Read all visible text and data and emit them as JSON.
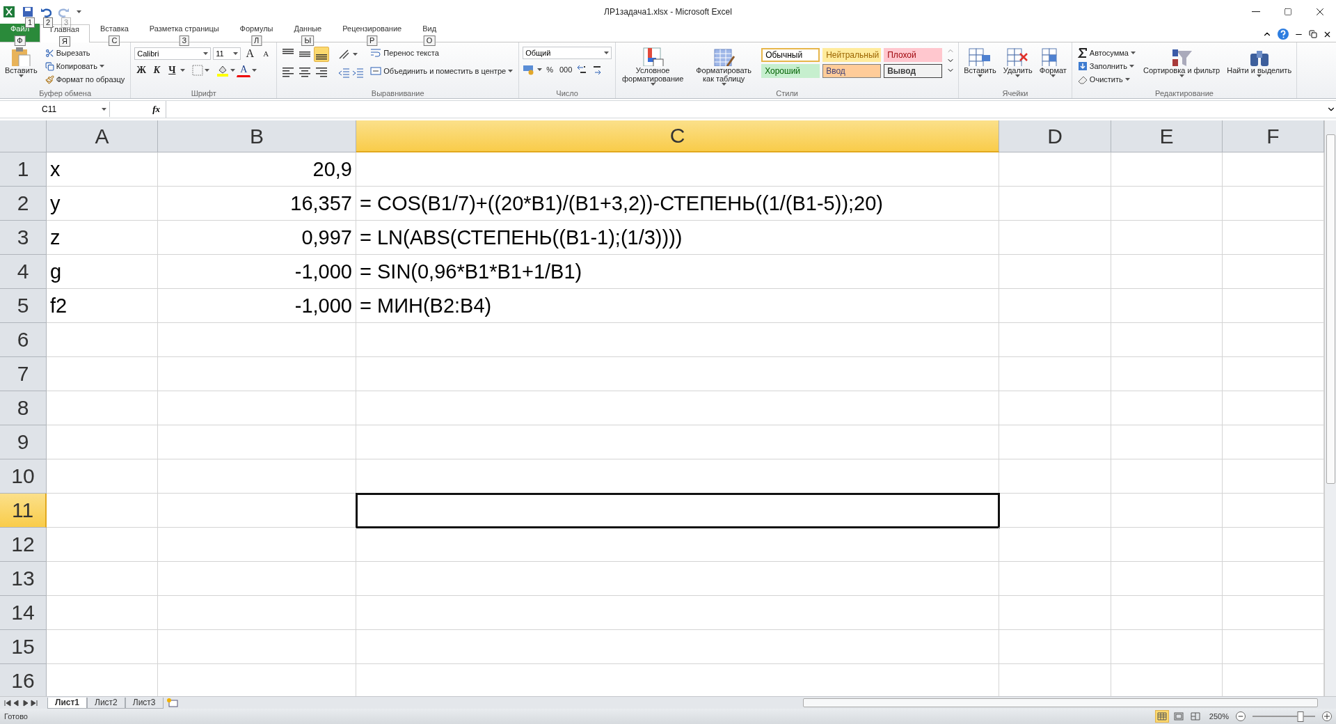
{
  "window": {
    "title": "ЛР1задача1.xlsx  -  Microsoft Excel"
  },
  "quick_access": [
    {
      "kind": "save",
      "keytip": "1",
      "disabled": false
    },
    {
      "kind": "undo",
      "keytip": "2",
      "disabled": false
    },
    {
      "kind": "redo",
      "keytip": "3",
      "disabled": true
    }
  ],
  "tabs": [
    {
      "label": "Файл",
      "keytip": "Ф",
      "kind": "file",
      "selected": false
    },
    {
      "label": "Главная",
      "keytip": "Я",
      "kind": "tab",
      "selected": true
    },
    {
      "label": "Вставка",
      "keytip": "С",
      "kind": "tab",
      "selected": false
    },
    {
      "label": "Разметка страницы",
      "keytip": "З",
      "kind": "tab",
      "selected": false
    },
    {
      "label": "Формулы",
      "keytip": "Л",
      "kind": "tab",
      "selected": false
    },
    {
      "label": "Данные",
      "keytip": "Ы",
      "kind": "tab",
      "selected": false
    },
    {
      "label": "Рецензирование",
      "keytip": "Р",
      "kind": "tab",
      "selected": false
    },
    {
      "label": "Вид",
      "keytip": "О",
      "kind": "tab",
      "selected": false
    }
  ],
  "ribbon": {
    "clipboard": {
      "label": "Буфер обмена",
      "paste": "Вставить",
      "items": [
        {
          "kind": "cut",
          "label": "Вырезать",
          "menu": false
        },
        {
          "kind": "copy",
          "label": "Копировать",
          "menu": true
        },
        {
          "kind": "brush",
          "label": "Формат по образцу",
          "menu": false
        }
      ]
    },
    "font": {
      "label": "Шрифт",
      "family": "Calibri",
      "size": "11",
      "grow": "A",
      "shrink": "A",
      "bold": "Ж",
      "italic": "К",
      "underline": "Ч",
      "color_letter": "A"
    },
    "alignment": {
      "label": "Выравнивание",
      "buttons": [
        {
          "kind": "top",
          "selected": false
        },
        {
          "kind": "middle",
          "selected": false
        },
        {
          "kind": "bottom",
          "selected": true
        },
        {
          "kind": "left",
          "selected": false
        },
        {
          "kind": "center",
          "selected": false
        },
        {
          "kind": "right",
          "selected": false
        }
      ],
      "wrap": "Перенос текста",
      "merge": "Объединить и поместить в центре"
    },
    "number": {
      "label": "Число",
      "format": "Общий",
      "percent": "%",
      "thousands": "000"
    },
    "styles": {
      "label": "Стили",
      "conditional": "Условное форматирование",
      "as_table": "Форматировать как таблицу",
      "cells": [
        {
          "label": "Обычный",
          "kind": "normal",
          "selected": true
        },
        {
          "label": "Нейтральный",
          "kind": "neutral",
          "selected": false
        },
        {
          "label": "Плохой",
          "kind": "bad",
          "selected": false
        },
        {
          "label": "Хороший",
          "kind": "good",
          "selected": false
        },
        {
          "label": "Ввод",
          "kind": "input",
          "selected": false
        },
        {
          "label": "Вывод",
          "kind": "output",
          "selected": false
        }
      ]
    },
    "cells": {
      "label": "Ячейки",
      "buttons": [
        {
          "kind": "insert",
          "label": "Вставить"
        },
        {
          "kind": "delete",
          "label": "Удалить"
        },
        {
          "kind": "format",
          "label": "Формат"
        }
      ]
    },
    "editing": {
      "label": "Редактирование",
      "items": [
        {
          "kind": "sum",
          "label": "Автосумма"
        },
        {
          "kind": "fill",
          "label": "Заполнить"
        },
        {
          "kind": "clear",
          "label": "Очистить"
        }
      ],
      "sort": "Сортировка и фильтр",
      "find": "Найти и выделить"
    }
  },
  "formula_bar": {
    "name_box": "C11",
    "fx": "fx"
  },
  "columns": [
    {
      "label": "A",
      "selected": false
    },
    {
      "label": "B",
      "selected": false
    },
    {
      "label": "C",
      "selected": true
    },
    {
      "label": "D",
      "selected": false
    },
    {
      "label": "E",
      "selected": false
    },
    {
      "label": "F",
      "selected": false
    }
  ],
  "rows": [
    {
      "header": "1",
      "selected": false,
      "cells": [
        "x",
        "20,9"
      ]
    },
    {
      "header": "2",
      "selected": false,
      "cells": [
        "y",
        "16,357",
        "= COS(B1/7)+((20*B1)/(B1+3,2))-СТЕПЕНЬ((1/(B1-5));20)"
      ]
    },
    {
      "header": "3",
      "selected": false,
      "cells": [
        "z",
        "0,997",
        "= LN(ABS(СТЕПЕНЬ((B1-1);(1/3))))"
      ]
    },
    {
      "header": "4",
      "selected": false,
      "cells": [
        "g",
        "-1,000",
        "= SIN(0,96*B1*B1+1/B1)"
      ]
    },
    {
      "header": "5",
      "selected": false,
      "cells": [
        "f2",
        "-1,000",
        "= МИН(B2:B4)"
      ]
    },
    {
      "header": "6",
      "selected": false,
      "cells": []
    },
    {
      "header": "7",
      "selected": false,
      "cells": []
    },
    {
      "header": "8",
      "selected": false,
      "cells": []
    },
    {
      "header": "9",
      "selected": false,
      "cells": []
    },
    {
      "header": "10",
      "selected": false,
      "cells": []
    },
    {
      "header": "11",
      "selected": true,
      "cells": []
    },
    {
      "header": "12",
      "selected": false,
      "cells": []
    },
    {
      "header": "13",
      "selected": false,
      "cells": []
    },
    {
      "header": "14",
      "selected": false,
      "cells": []
    },
    {
      "header": "15",
      "selected": false,
      "cells": []
    },
    {
      "header": "16",
      "selected": false,
      "cells": []
    }
  ],
  "sheets": [
    {
      "label": "Лист1",
      "selected": true
    },
    {
      "label": "Лист2",
      "selected": false
    },
    {
      "label": "Лист3",
      "selected": false
    }
  ],
  "status_bar": {
    "text": "Готово",
    "views": [
      {
        "kind": "normal",
        "selected": true
      },
      {
        "kind": "layout",
        "selected": false
      },
      {
        "kind": "pagebreak",
        "selected": false
      }
    ],
    "zoom": "250%",
    "zoom_slider": {
      "level": 0.77
    }
  }
}
